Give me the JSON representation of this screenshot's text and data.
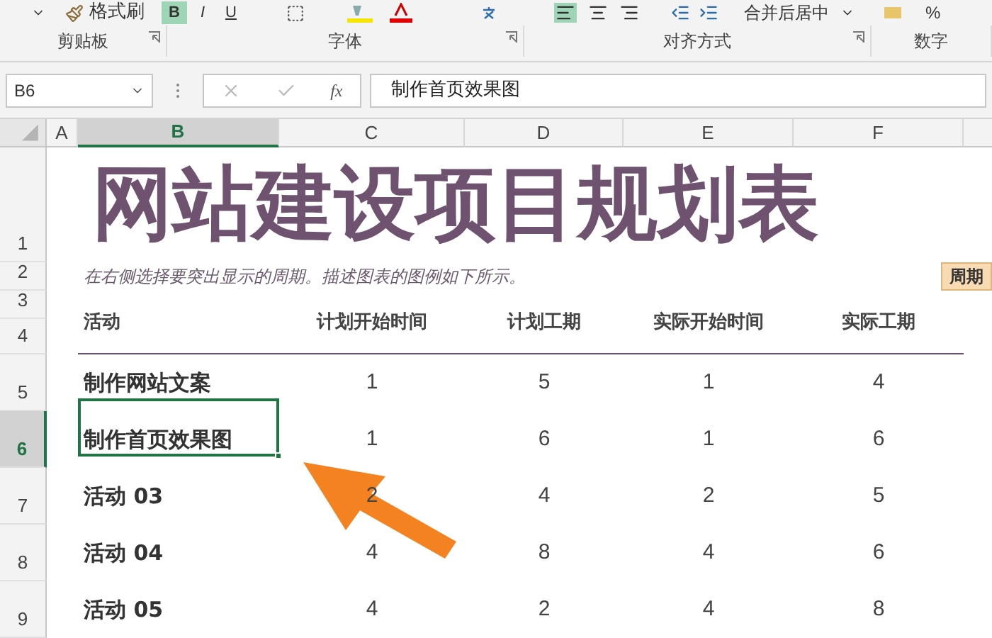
{
  "ribbon": {
    "format_painter": "格式刷",
    "font_buttons": [
      {
        "label": "B",
        "selected": true
      },
      {
        "label": "I",
        "selected": false
      },
      {
        "label": "U",
        "selected": false
      }
    ],
    "merge_button": "合并后居中",
    "percent": "%",
    "groups": [
      "剪贴板",
      "字体",
      "对齐方式",
      "数字"
    ]
  },
  "formula_bar": {
    "name_box": "B6",
    "fx": "fx",
    "value": "制作首页效果图"
  },
  "columns": [
    {
      "label": "A",
      "selected": false
    },
    {
      "label": "B",
      "selected": true
    },
    {
      "label": "C",
      "selected": false
    },
    {
      "label": "D",
      "selected": false
    },
    {
      "label": "E",
      "selected": false
    },
    {
      "label": "F",
      "selected": false
    }
  ],
  "row_numbers": [
    {
      "label": "1",
      "selected": false
    },
    {
      "label": "2",
      "selected": false
    },
    {
      "label": "3",
      "selected": false
    },
    {
      "label": "4",
      "selected": false
    },
    {
      "label": "5",
      "selected": false
    },
    {
      "label": "6",
      "selected": true
    },
    {
      "label": "7",
      "selected": false
    },
    {
      "label": "8",
      "selected": false
    },
    {
      "label": "9",
      "selected": false
    }
  ],
  "sheet": {
    "title": "网站建设项目规划表",
    "subtitle": "在右侧选择要突出显示的周期。描述图表的图例如下所示。",
    "period_label": "周期",
    "headers": [
      "活动",
      "计划开始时间",
      "计划工期",
      "实际开始时间",
      "实际工期"
    ],
    "activities": [
      {
        "cells": [
          "制作网站文案",
          "1",
          "5",
          "1",
          "4"
        ],
        "selected": false
      },
      {
        "cells": [
          "制作首页效果图",
          "1",
          "6",
          "1",
          "6"
        ],
        "selected": true
      },
      {
        "cells": [
          "活动 03",
          "2",
          "4",
          "2",
          "5"
        ],
        "selected": false
      },
      {
        "cells": [
          "活动 04",
          "4",
          "8",
          "4",
          "6"
        ],
        "selected": false
      },
      {
        "cells": [
          "活动 05",
          "4",
          "2",
          "4",
          "8"
        ],
        "selected": false
      }
    ]
  }
}
